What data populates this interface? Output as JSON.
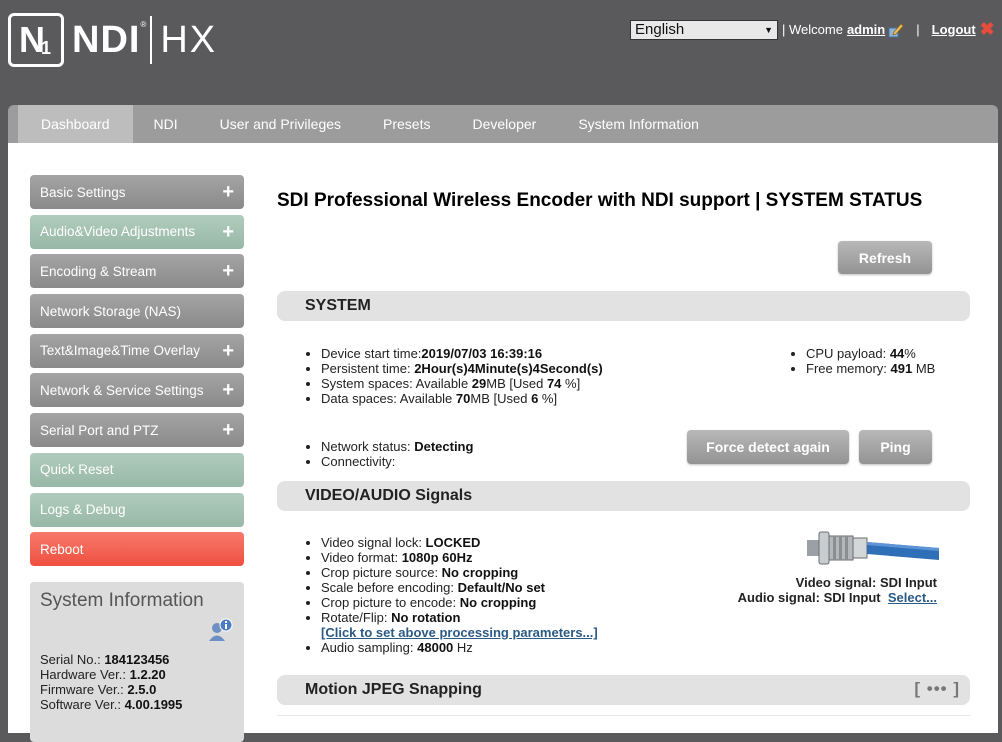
{
  "header": {
    "logo_box": "N",
    "logo_box_sub": "1",
    "logo_text": "NDI",
    "logo_tm": "®",
    "logo_hx": "HX",
    "language": "English",
    "welcome": "| Welcome",
    "user": "admin",
    "separator": "|",
    "logout": "Logout"
  },
  "nav": {
    "tabs": [
      "Dashboard",
      "NDI",
      "User and Privileges",
      "Presets",
      "Developer",
      "System Information"
    ]
  },
  "sidebar": {
    "items": [
      {
        "label": "Basic Settings",
        "expand": "+"
      },
      {
        "label": "Audio&Video Adjustments",
        "expand": "+"
      },
      {
        "label": "Encoding & Stream",
        "expand": "+"
      },
      {
        "label": "Network Storage (NAS)",
        "expand": ""
      },
      {
        "label": "Text&Image&Time Overlay",
        "expand": "+"
      },
      {
        "label": "Network & Service Settings",
        "expand": "+"
      },
      {
        "label": "Serial Port and PTZ",
        "expand": "+"
      },
      {
        "label": "Quick Reset",
        "expand": ""
      },
      {
        "label": "Logs & Debug",
        "expand": ""
      },
      {
        "label": "Reboot",
        "expand": ""
      }
    ],
    "sysinfo": {
      "title": "System Information",
      "serial_label": "Serial No.:",
      "serial": "184123456",
      "hardware_label": "Hardware Ver.:",
      "hardware": "1.2.20",
      "firmware_label": "Firmware Ver.:",
      "firmware": "2.5.0",
      "software_label": "Software Ver.:",
      "software": "4.00.1995"
    }
  },
  "main": {
    "title": "SDI Professional Wireless Encoder with NDI support | SYSTEM STATUS",
    "refresh": "Refresh",
    "system": {
      "heading": "SYSTEM",
      "start_label": "Device start time:",
      "start": "2019/07/03 16:39:16",
      "persist_label": "Persistent time: ",
      "persist": "2Hour(s)4Minute(s)4Second(s)",
      "sys_space_label": "System spaces: Available ",
      "sys_space_avail": "29",
      "sys_space_mid": "MB [Used ",
      "sys_space_used": "74",
      "sys_space_end": " %]",
      "data_space_label": "Data spaces: Available ",
      "data_space_avail": "70",
      "data_space_mid": "MB [Used ",
      "data_space_used": "6",
      "data_space_end": " %]",
      "cpu_label": "CPU payload: ",
      "cpu": "44",
      "cpu_unit": "%",
      "mem_label": "Free memory: ",
      "mem": "491",
      "mem_unit": " MB",
      "net_label": "Network status: ",
      "net": "Detecting",
      "conn_label": "Connectivity:",
      "force": "Force detect again",
      "ping": "Ping"
    },
    "video": {
      "heading": "VIDEO/AUDIO Signals",
      "lock_label": "Video signal lock: ",
      "lock": "LOCKED",
      "format_label": "Video format: ",
      "format": "1080p 60Hz",
      "crop_src_label": "Crop picture source: ",
      "crop_src": "No cropping",
      "scale_label": "Scale before encoding: ",
      "scale": "Default/No set",
      "crop_enc_label": "Crop picture to encode: ",
      "crop_enc": "No cropping",
      "rotate_label": "Rotate/Flip: ",
      "rotate": "No rotation",
      "proc_link": "[Click to set above processing parameters...]",
      "audio_label": "Audio sampling: ",
      "audio": "48000",
      "audio_unit": " Hz",
      "video_signal": "Video signal: SDI Input",
      "audio_signal": "Audio signal: SDI Input",
      "select": "Select..."
    },
    "mjpeg": {
      "heading": "Motion JPEG Snapping",
      "more": "[ ••• ]"
    }
  },
  "colors": {
    "header_bg": "#5a5a5c",
    "nav_bg": "#9c9c9c",
    "sidebar_gray": "#8a8a8a",
    "sidebar_green": "#98b8a7",
    "sidebar_red": "#ef4f40",
    "section_bg": "#e2e2e2",
    "link": "#2b5a85"
  }
}
